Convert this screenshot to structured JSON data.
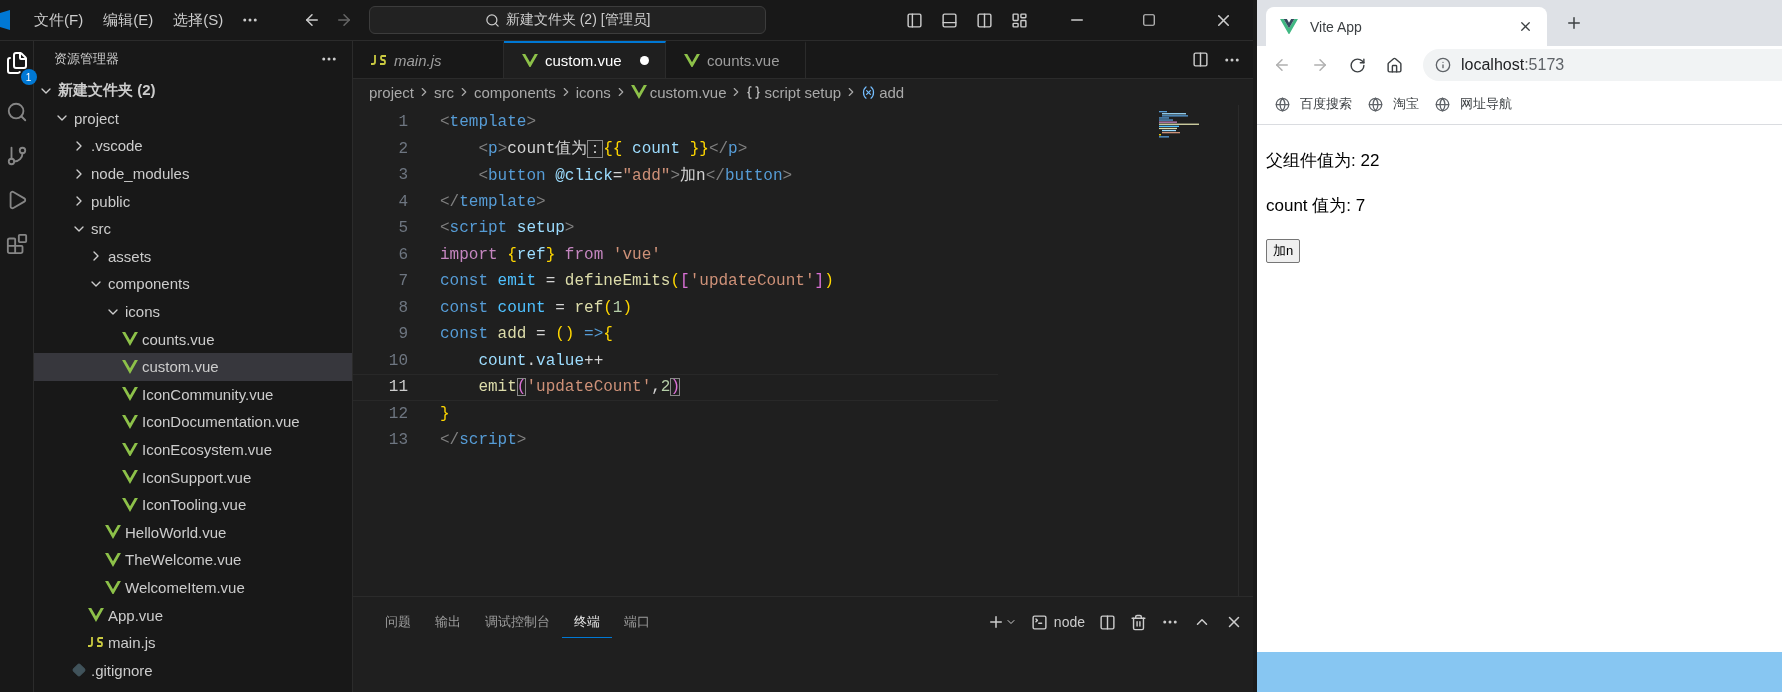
{
  "vscode": {
    "menu": [
      "文件(F)",
      "编辑(E)",
      "选择(S)"
    ],
    "command_center": "新建文件夹 (2) [管理员]",
    "activity_badge": "1",
    "explorer": {
      "title": "资源管理器",
      "root": {
        "label": "新建文件夹 (2)",
        "expanded": true
      },
      "tree": [
        {
          "label": "project",
          "kind": "folder",
          "expanded": true,
          "selected": false,
          "children": [
            {
              "label": ".vscode",
              "kind": "folder",
              "expanded": false,
              "selected": false
            },
            {
              "label": "node_modules",
              "kind": "folder",
              "expanded": false,
              "selected": false
            },
            {
              "label": "public",
              "kind": "folder",
              "expanded": false,
              "selected": false
            },
            {
              "label": "src",
              "kind": "folder",
              "expanded": true,
              "selected": false,
              "children": [
                {
                  "label": "assets",
                  "kind": "folder",
                  "expanded": false,
                  "selected": false
                },
                {
                  "label": "components",
                  "kind": "folder",
                  "expanded": true,
                  "selected": false,
                  "children": [
                    {
                      "label": "icons",
                      "kind": "folder",
                      "expanded": true,
                      "selected": false,
                      "children": [
                        {
                          "label": "counts.vue",
                          "kind": "vue",
                          "selected": false
                        },
                        {
                          "label": "custom.vue",
                          "kind": "vue",
                          "selected": true
                        },
                        {
                          "label": "IconCommunity.vue",
                          "kind": "vue",
                          "selected": false
                        },
                        {
                          "label": "IconDocumentation.vue",
                          "kind": "vue",
                          "selected": false
                        },
                        {
                          "label": "IconEcosystem.vue",
                          "kind": "vue",
                          "selected": false
                        },
                        {
                          "label": "IconSupport.vue",
                          "kind": "vue",
                          "selected": false
                        },
                        {
                          "label": "IconTooling.vue",
                          "kind": "vue",
                          "selected": false
                        }
                      ]
                    },
                    {
                      "label": "HelloWorld.vue",
                      "kind": "vue",
                      "selected": false
                    },
                    {
                      "label": "TheWelcome.vue",
                      "kind": "vue",
                      "selected": false
                    },
                    {
                      "label": "WelcomeItem.vue",
                      "kind": "vue",
                      "selected": false
                    }
                  ]
                },
                {
                  "label": "App.vue",
                  "kind": "vue",
                  "selected": false
                },
                {
                  "label": "main.js",
                  "kind": "js",
                  "selected": false
                }
              ]
            },
            {
              "label": ".gitignore",
              "kind": "git",
              "selected": false
            }
          ]
        }
      ]
    },
    "tabs": [
      {
        "label": "main.js",
        "kind": "js",
        "selected": false,
        "preview": true,
        "modified": false
      },
      {
        "label": "custom.vue",
        "kind": "vue",
        "selected": true,
        "preview": false,
        "modified": true
      },
      {
        "label": "counts.vue",
        "kind": "vue",
        "selected": false,
        "preview": false,
        "modified": false
      }
    ],
    "breadcrumb": [
      {
        "label": "project",
        "kind": "plain"
      },
      {
        "label": "src",
        "kind": "plain"
      },
      {
        "label": "components",
        "kind": "plain"
      },
      {
        "label": "icons",
        "kind": "plain"
      },
      {
        "label": "custom.vue",
        "kind": "vue"
      },
      {
        "label": "script setup",
        "kind": "braces"
      },
      {
        "label": "add",
        "kind": "variable"
      }
    ],
    "code": [
      {
        "number": "1",
        "current": false,
        "segments": [
          {
            "kind": "punct",
            "text": "<"
          },
          {
            "kind": "tag",
            "text": "template"
          },
          {
            "kind": "punct",
            "text": ">"
          }
        ]
      },
      {
        "number": "2",
        "current": false,
        "segments": [
          {
            "kind": "punct",
            "text": "    <"
          },
          {
            "kind": "tag",
            "text": "p"
          },
          {
            "kind": "punct",
            "text": ">"
          },
          {
            "kind": "plain",
            "text": "count值为"
          },
          {
            "kind": "plain",
            "text": "：",
            "boxed": true
          },
          {
            "kind": "bracket",
            "text": "{{"
          },
          {
            "kind": "attr",
            "text": " count "
          },
          {
            "kind": "bracket",
            "text": "}}"
          },
          {
            "kind": "punct",
            "text": "</"
          },
          {
            "kind": "tag",
            "text": "p"
          },
          {
            "kind": "punct",
            "text": ">"
          }
        ]
      },
      {
        "number": "3",
        "current": false,
        "segments": [
          {
            "kind": "punct",
            "text": "    <"
          },
          {
            "kind": "tag",
            "text": "button"
          },
          {
            "kind": "attr",
            "text": " @click"
          },
          {
            "kind": "plain",
            "text": "="
          },
          {
            "kind": "string",
            "text": "\"add\""
          },
          {
            "kind": "punct",
            "text": ">"
          },
          {
            "kind": "plain",
            "text": "加n"
          },
          {
            "kind": "punct",
            "text": "</"
          },
          {
            "kind": "tag",
            "text": "button"
          },
          {
            "kind": "punct",
            "text": ">"
          }
        ]
      },
      {
        "number": "4",
        "current": false,
        "segments": [
          {
            "kind": "punct",
            "text": "</"
          },
          {
            "kind": "tag",
            "text": "template"
          },
          {
            "kind": "punct",
            "text": ">"
          }
        ]
      },
      {
        "number": "5",
        "current": false,
        "segments": [
          {
            "kind": "punct",
            "text": "<"
          },
          {
            "kind": "tag",
            "text": "script"
          },
          {
            "kind": "attr",
            "text": " setup"
          },
          {
            "kind": "punct",
            "text": ">"
          }
        ]
      },
      {
        "number": "6",
        "current": false,
        "segments": [
          {
            "kind": "keyword",
            "text": "import"
          },
          {
            "kind": "bracket",
            "text": " {"
          },
          {
            "kind": "attr",
            "text": "ref"
          },
          {
            "kind": "bracket",
            "text": "}"
          },
          {
            "kind": "keyword",
            "text": " from"
          },
          {
            "kind": "string",
            "text": " 'vue'"
          }
        ]
      },
      {
        "number": "7",
        "current": false,
        "segments": [
          {
            "kind": "storage",
            "text": "const"
          },
          {
            "kind": "variable",
            "text": " emit"
          },
          {
            "kind": "plain",
            "text": " = "
          },
          {
            "kind": "function",
            "text": "defineEmits"
          },
          {
            "kind": "bracket",
            "text": "("
          },
          {
            "kind": "bracket2",
            "text": "["
          },
          {
            "kind": "string",
            "text": "'updateCount'"
          },
          {
            "kind": "bracket2",
            "text": "]"
          },
          {
            "kind": "bracket",
            "text": ")"
          }
        ]
      },
      {
        "number": "8",
        "current": false,
        "segments": [
          {
            "kind": "storage",
            "text": "const"
          },
          {
            "kind": "variable",
            "text": " count"
          },
          {
            "kind": "plain",
            "text": " = "
          },
          {
            "kind": "function",
            "text": "ref"
          },
          {
            "kind": "bracket",
            "text": "("
          },
          {
            "kind": "number",
            "text": "1"
          },
          {
            "kind": "bracket",
            "text": ")"
          }
        ]
      },
      {
        "number": "9",
        "current": false,
        "segments": [
          {
            "kind": "storage",
            "text": "const"
          },
          {
            "kind": "function",
            "text": " add"
          },
          {
            "kind": "plain",
            "text": " = "
          },
          {
            "kind": "bracket",
            "text": "()"
          },
          {
            "kind": "storage",
            "text": " =>"
          },
          {
            "kind": "bracket",
            "text": "{"
          }
        ]
      },
      {
        "number": "10",
        "current": false,
        "segments": [
          {
            "kind": "attr",
            "text": "    count"
          },
          {
            "kind": "plain",
            "text": "."
          },
          {
            "kind": "attr",
            "text": "value"
          },
          {
            "kind": "plain",
            "text": "++"
          }
        ]
      },
      {
        "number": "11",
        "current": true,
        "segments": [
          {
            "kind": "function",
            "text": "    emit"
          },
          {
            "kind": "bracket2",
            "text": "(",
            "boxed": true
          },
          {
            "kind": "string",
            "text": "'updateCount'"
          },
          {
            "kind": "plain",
            "text": ","
          },
          {
            "kind": "number",
            "text": "2"
          },
          {
            "kind": "bracket2",
            "text": ")",
            "boxed": true
          }
        ]
      },
      {
        "number": "12",
        "current": false,
        "segments": [
          {
            "kind": "bracket",
            "text": "}"
          }
        ]
      },
      {
        "number": "13",
        "current": false,
        "segments": [
          {
            "kind": "punct",
            "text": "</"
          },
          {
            "kind": "tag",
            "text": "script"
          },
          {
            "kind": "punct",
            "text": ">"
          }
        ]
      }
    ],
    "panel": {
      "tabs": [
        {
          "label": "问题",
          "selected": false
        },
        {
          "label": "输出",
          "selected": false
        },
        {
          "label": "调试控制台",
          "selected": false
        },
        {
          "label": "终端",
          "selected": true
        },
        {
          "label": "端口",
          "selected": false
        }
      ],
      "terminal_name": "node"
    }
  },
  "browser": {
    "tab": {
      "title": "Vite App"
    },
    "address": {
      "host": "localhost",
      "port": ":5173"
    },
    "bookmarks": [
      "百度搜索",
      "淘宝",
      "网址导航"
    ],
    "page": {
      "lines": [
        "父组件值为: 22",
        "count 值为: 7"
      ],
      "button": "加n"
    }
  }
}
